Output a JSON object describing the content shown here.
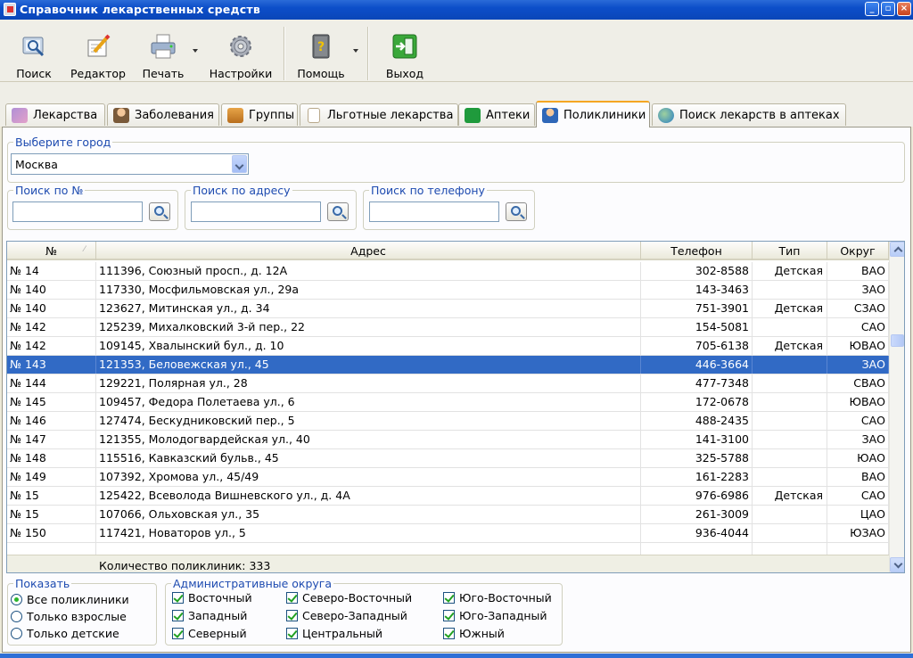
{
  "window": {
    "title": "Справочник лекарственных средств"
  },
  "toolbar": {
    "search": "Поиск",
    "editor": "Редактор",
    "print": "Печать",
    "settings": "Настройки",
    "help": "Помощь",
    "exit": "Выход"
  },
  "tabs": [
    {
      "label": "Лекарства",
      "active": false
    },
    {
      "label": "Заболевания",
      "active": false
    },
    {
      "label": "Группы",
      "active": false
    },
    {
      "label": "Льготные лекарства",
      "active": false
    },
    {
      "label": "Аптеки",
      "active": false
    },
    {
      "label": "Поликлиники",
      "active": true
    },
    {
      "label": "Поиск лекарств в аптеках",
      "active": false
    }
  ],
  "city": {
    "legend": "Выберите город",
    "value": "Москва"
  },
  "search": {
    "by_number": {
      "legend": "Поиск по №",
      "value": ""
    },
    "by_address": {
      "legend": "Поиск по адресу",
      "value": ""
    },
    "by_phone": {
      "legend": "Поиск по телефону",
      "value": ""
    }
  },
  "grid": {
    "columns": {
      "num": "№",
      "address": "Адрес",
      "phone": "Телефон",
      "type": "Тип",
      "district": "Округ"
    },
    "sort_indicator": "⁄",
    "rows": [
      {
        "num": "№ 14",
        "address": "111396, Союзный просп., д. 12А",
        "phone": "302-8588",
        "type": "Детская",
        "district": "ВАО"
      },
      {
        "num": "№ 140",
        "address": "117330, Мосфильмовская ул., 29а",
        "phone": "143-3463",
        "type": "",
        "district": "ЗАО"
      },
      {
        "num": "№ 140",
        "address": "123627, Митинская ул., д. 34",
        "phone": "751-3901",
        "type": "Детская",
        "district": "СЗАО"
      },
      {
        "num": "№ 142",
        "address": "125239, Михалковский 3-й пер., 22",
        "phone": "154-5081",
        "type": "",
        "district": "САО"
      },
      {
        "num": "№ 142",
        "address": "109145, Хвалынский бул., д. 10",
        "phone": "705-6138",
        "type": "Детская",
        "district": "ЮВАО"
      },
      {
        "num": "№ 143",
        "address": "121353, Беловежская ул., 45",
        "phone": "446-3664",
        "type": "",
        "district": "ЗАО",
        "selected": true
      },
      {
        "num": "№ 144",
        "address": "129221, Полярная ул., 28",
        "phone": "477-7348",
        "type": "",
        "district": "СВАО"
      },
      {
        "num": "№ 145",
        "address": "109457, Федора Полетаева ул., 6",
        "phone": "172-0678",
        "type": "",
        "district": "ЮВАО"
      },
      {
        "num": "№ 146",
        "address": "127474, Бескудниковский пер., 5",
        "phone": "488-2435",
        "type": "",
        "district": "САО"
      },
      {
        "num": "№ 147",
        "address": "121355, Молодогвардейская ул., 40",
        "phone": "141-3100",
        "type": "",
        "district": "ЗАО"
      },
      {
        "num": "№ 148",
        "address": "115516, Кавказский бульв., 45",
        "phone": "325-5788",
        "type": "",
        "district": "ЮАО"
      },
      {
        "num": "№ 149",
        "address": "107392, Хромова ул., 45/49",
        "phone": "161-2283",
        "type": "",
        "district": "ВАО"
      },
      {
        "num": "№ 15",
        "address": "125422, Всеволода Вишневского ул., д. 4А",
        "phone": "976-6986",
        "type": "Детская",
        "district": "САО"
      },
      {
        "num": "№ 15",
        "address": "107066, Ольховская ул., 35",
        "phone": "261-3009",
        "type": "",
        "district": "ЦАО"
      },
      {
        "num": "№ 150",
        "address": "117421, Новаторов ул., 5",
        "phone": "936-4044",
        "type": "",
        "district": "ЮЗАО"
      }
    ],
    "footer": "Количество поликлиник: 333"
  },
  "show": {
    "legend": "Показать",
    "options": [
      {
        "label": "Все поликлиники",
        "checked": true
      },
      {
        "label": "Только взрослые",
        "checked": false
      },
      {
        "label": "Только детские",
        "checked": false
      }
    ]
  },
  "districts": {
    "legend": "Административные округа",
    "items": [
      {
        "label": "Восточный",
        "checked": true
      },
      {
        "label": "Западный",
        "checked": true
      },
      {
        "label": "Северный",
        "checked": true
      },
      {
        "label": "Северо-Восточный",
        "checked": true
      },
      {
        "label": "Северо-Западный",
        "checked": true
      },
      {
        "label": "Центральный",
        "checked": true
      },
      {
        "label": "Юго-Восточный",
        "checked": true
      },
      {
        "label": "Юго-Западный",
        "checked": true
      },
      {
        "label": "Южный",
        "checked": true
      }
    ]
  },
  "colors": {
    "selection": "#316ac5",
    "legend_text": "#1e4bb0",
    "titlebar": "#0c4ec9"
  }
}
